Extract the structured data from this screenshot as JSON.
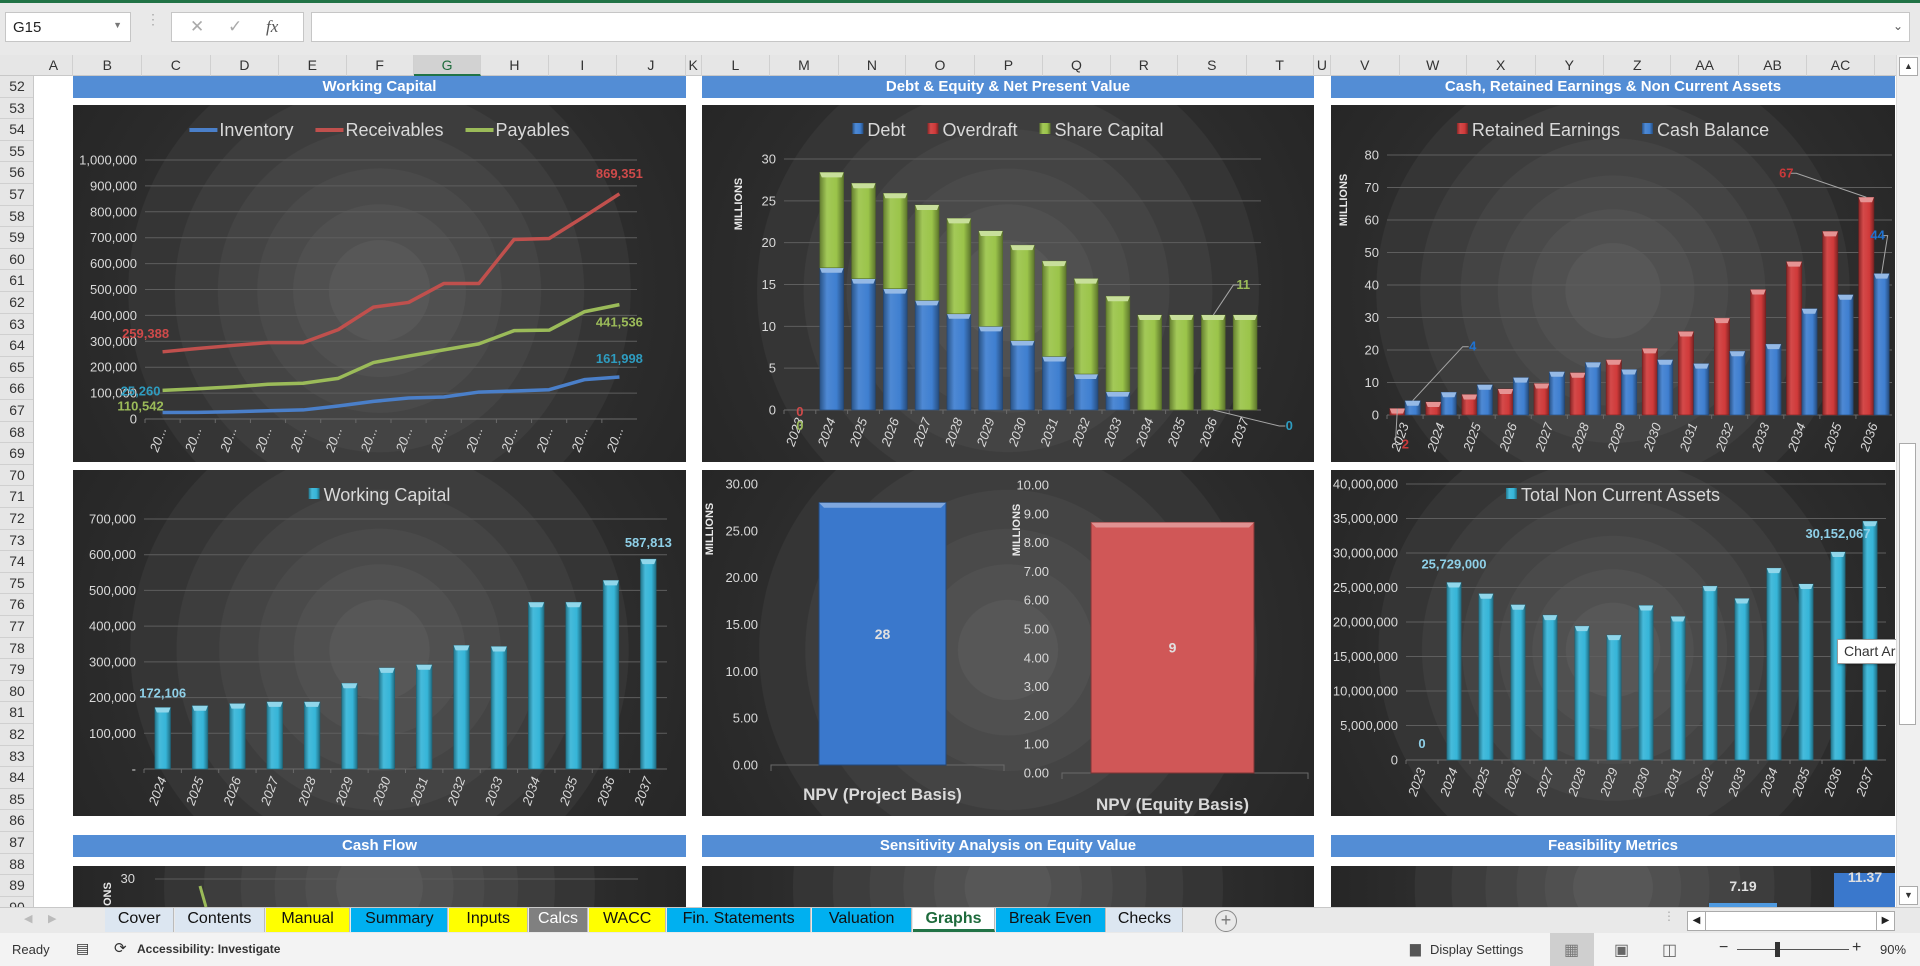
{
  "formula_bar": {
    "name_box": "G15",
    "cancel_icon": "✕",
    "enter_icon": "✓",
    "fx_label": "fx",
    "formula": ""
  },
  "columns": [
    "A",
    "B",
    "C",
    "D",
    "E",
    "F",
    "G",
    "H",
    "I",
    "J",
    "K",
    "L",
    "M",
    "N",
    "O",
    "P",
    "Q",
    "R",
    "S",
    "T",
    "U",
    "V",
    "W",
    "X",
    "Y",
    "Z",
    "AA",
    "AB",
    "AC"
  ],
  "selected_column": "G",
  "rows": [
    52,
    53,
    54,
    55,
    56,
    57,
    58,
    59,
    60,
    61,
    62,
    63,
    64,
    65,
    66,
    67,
    68,
    69,
    70,
    71,
    72,
    73,
    74,
    75,
    76,
    77,
    78,
    79,
    80,
    81,
    82,
    83,
    84,
    85,
    86,
    87,
    88,
    89,
    90
  ],
  "sections": {
    "working_capital": "Working Capital",
    "debt_equity": "Debt & Equity & Net Present Value",
    "cash_re": "Cash, Retained Earnings & Non Current Assets",
    "cash_flow": "Cash Flow",
    "sensitivity": "Sensitivity Analysis on Equity Value",
    "feasibility": "Feasibility Metrics"
  },
  "chart_data": [
    {
      "id": "wc_lines",
      "type": "line",
      "x_tick_labels": [
        "20...",
        "20...",
        "20...",
        "20...",
        "20...",
        "20...",
        "20...",
        "20...",
        "20...",
        "20...",
        "20...",
        "20...",
        "20...",
        "20..."
      ],
      "ylim": [
        0,
        1000000
      ],
      "y_tick_labels": [
        "0",
        "100,000",
        "200,000",
        "300,000",
        "400,000",
        "500,000",
        "600,000",
        "700,000",
        "800,000",
        "900,000",
        "1,000,000"
      ],
      "grid": true,
      "legend": "top",
      "series": [
        {
          "name": "Inventory",
          "color": "#4a7fc9",
          "values": [
            25260,
            25500,
            28000,
            32000,
            35000,
            50000,
            68000,
            81000,
            85000,
            104000,
            108000,
            113000,
            152000,
            161998
          ]
        },
        {
          "name": "Receivables",
          "color": "#c0504d",
          "values": [
            259388,
            272000,
            284000,
            295000,
            295000,
            345000,
            432000,
            450000,
            523000,
            523000,
            693000,
            697000,
            782000,
            869351
          ]
        },
        {
          "name": "Payables",
          "color": "#9bbb59",
          "values": [
            110542,
            117000,
            124000,
            134000,
            138000,
            157000,
            218000,
            243000,
            267000,
            290000,
            341000,
            343000,
            414000,
            441536
          ]
        }
      ],
      "data_labels": [
        {
          "series": 1,
          "index": 0,
          "text": "259,388",
          "color": "#d04a4a"
        },
        {
          "series": 1,
          "index": 13,
          "text": "869,351",
          "color": "#d04a4a"
        },
        {
          "series": 2,
          "index": 13,
          "text": "441,536",
          "color": "#9bbb59"
        },
        {
          "series": 0,
          "index": 13,
          "text": "161,998",
          "color": "#2e9cc0"
        },
        {
          "series": 0,
          "index": 0,
          "text": "25,260",
          "color": "#2e9cc0"
        },
        {
          "series": 2,
          "index": 0,
          "text": "110,542",
          "color": "#9bbb59"
        }
      ]
    },
    {
      "id": "debt_equity",
      "type": "bar",
      "stacked": true,
      "x_tick_labels": [
        "2023",
        "2024",
        "2025",
        "2026",
        "2027",
        "2028",
        "2029",
        "2030",
        "2031",
        "2032",
        "2033",
        "2034",
        "2035",
        "2036",
        "2037"
      ],
      "ylim": [
        0,
        30
      ],
      "y_tick_labels": [
        "0",
        "5",
        "10",
        "15",
        "20",
        "25",
        "30"
      ],
      "ylabel": "MILLIONS",
      "grid": true,
      "legend": "top",
      "series": [
        {
          "name": "Debt",
          "color": "#3f7fd0",
          "values": [
            0,
            17.0,
            15.7,
            14.5,
            13.1,
            11.5,
            10.0,
            8.3,
            6.4,
            4.3,
            2.2,
            0,
            0,
            0,
            0
          ]
        },
        {
          "name": "Overdraft",
          "color": "#d03a3a",
          "values": [
            0,
            0,
            0,
            0,
            0,
            0,
            0,
            0,
            0,
            0,
            0,
            0,
            0,
            0,
            0
          ]
        },
        {
          "name": "Share Capital",
          "color": "#9bc44a",
          "values": [
            0,
            11.4,
            11.4,
            11.4,
            11.4,
            11.4,
            11.4,
            11.4,
            11.4,
            11.4,
            11.4,
            11.35,
            11.35,
            11.35,
            11.35
          ]
        }
      ],
      "data_labels": [
        {
          "series": 1,
          "index": 0,
          "text": "0",
          "color": "#d04a4a"
        },
        {
          "series": 2,
          "index": 0,
          "text": "0",
          "color": "#9bbb59"
        },
        {
          "series": 2,
          "index": 13,
          "text": "11",
          "color": "#9bbb59"
        },
        {
          "series": 0,
          "index": 13,
          "text": "0",
          "color": "#2e9cc0"
        }
      ]
    },
    {
      "id": "cash_re",
      "type": "bar",
      "stacked": false,
      "x_tick_labels": [
        "2023",
        "2024",
        "2025",
        "2026",
        "2027",
        "2028",
        "2029",
        "2030",
        "2031",
        "2032",
        "2033",
        "2034",
        "2035",
        "2036"
      ],
      "ylim": [
        0,
        80
      ],
      "y_tick_labels": [
        "0",
        "10",
        "20",
        "30",
        "40",
        "50",
        "60",
        "70",
        "80"
      ],
      "ylabel": "MILLIONS",
      "grid": true,
      "legend": "top",
      "series": [
        {
          "name": "Retained Earnings",
          "color": "#d03a3a",
          "values": [
            2,
            4,
            6.3,
            8,
            9.7,
            13,
            17,
            20.5,
            25.7,
            29.8,
            38.6,
            47.2,
            56.5,
            67
          ]
        },
        {
          "name": "Cash Balance",
          "color": "#3f7fd0",
          "values": [
            4.4,
            7,
            9.3,
            11.5,
            13.3,
            16.2,
            14,
            17,
            15.8,
            19.6,
            21.8,
            32.7,
            37,
            43.5
          ]
        }
      ],
      "data_labels": [
        {
          "series": 0,
          "index": 0,
          "text": "2",
          "color": "#c9393a"
        },
        {
          "series": 1,
          "index": 0,
          "text": "4",
          "color": "#1f72d0"
        },
        {
          "series": 0,
          "index": 13,
          "text": "67",
          "color": "#c9393a"
        },
        {
          "series": 1,
          "index": 13,
          "text": "44",
          "color": "#1f72d0"
        }
      ]
    },
    {
      "id": "wc_bars",
      "type": "bar",
      "stacked": false,
      "x_tick_labels": [
        "2024",
        "2025",
        "2026",
        "2027",
        "2028",
        "2029",
        "2030",
        "2031",
        "2032",
        "2033",
        "2034",
        "2035",
        "2036",
        "2037"
      ],
      "ylim": [
        0,
        700000
      ],
      "y_tick_labels": [
        "-",
        "100,000",
        "200,000",
        "300,000",
        "400,000",
        "500,000",
        "600,000",
        "700,000"
      ],
      "grid": true,
      "legend": "top",
      "series": [
        {
          "name": "Working Capital",
          "color": "#36b5d8",
          "values": [
            172106,
            177000,
            183000,
            188000,
            188000,
            240000,
            283000,
            292000,
            346000,
            343000,
            467000,
            467000,
            528000,
            587813
          ]
        }
      ],
      "data_labels": [
        {
          "series": 0,
          "index": 0,
          "text": "172,106",
          "color": "#8fd0e8"
        },
        {
          "series": 0,
          "index": 13,
          "text": "587,813",
          "color": "#8fd0e8"
        }
      ]
    },
    {
      "id": "npv_project",
      "type": "bar",
      "categories": [
        "NPV (Project Basis)"
      ],
      "values": [
        28.0
      ],
      "color": "#3a78cc",
      "ylim": [
        0,
        30
      ],
      "y_tick_labels": [
        "0.00",
        "5.00",
        "10.00",
        "15.00",
        "20.00",
        "25.00",
        "30.00"
      ],
      "ylabel": "MILLIONS",
      "data_label": "28"
    },
    {
      "id": "npv_equity",
      "type": "bar",
      "categories": [
        "NPV (Equity Basis)"
      ],
      "values": [
        8.7
      ],
      "color": "#d05757",
      "ylim": [
        0,
        10
      ],
      "y_tick_labels": [
        "0.00",
        "1.00",
        "2.00",
        "3.00",
        "4.00",
        "5.00",
        "6.00",
        "7.00",
        "8.00",
        "9.00",
        "10.00"
      ],
      "ylabel": "MILLIONS",
      "data_label": "9"
    },
    {
      "id": "tnca",
      "type": "bar",
      "stacked": false,
      "x_tick_labels": [
        "2023",
        "2024",
        "2025",
        "2026",
        "2027",
        "2028",
        "2029",
        "2030",
        "2031",
        "2032",
        "2033",
        "2034",
        "2035",
        "2036",
        "2037"
      ],
      "ylim": [
        0,
        40000000
      ],
      "y_tick_labels": [
        "0",
        "5,000,000",
        "10,000,000",
        "15,000,000",
        "20,000,000",
        "25,000,000",
        "30,000,000",
        "35,000,000",
        "40,000,000"
      ],
      "grid": true,
      "legend": "top",
      "series": [
        {
          "name": "Total Non Current Assets",
          "color": "#36b5d8",
          "values": [
            0,
            25729000,
            24100000,
            22500000,
            21000000,
            19400000,
            18100000,
            22400000,
            20800000,
            25200000,
            23400000,
            27800000,
            25500000,
            30152067,
            34600000
          ]
        }
      ],
      "data_labels": [
        {
          "series": 0,
          "index": 0,
          "text": "0",
          "color": "#8fd0e8"
        },
        {
          "series": 0,
          "index": 1,
          "text": "25,729,000",
          "color": "#8fd0e8"
        },
        {
          "series": 0,
          "index": 13,
          "text": "30,152,067",
          "color": "#8fd0e8"
        }
      ]
    }
  ],
  "partial_charts": {
    "cash_flow": {
      "y_tick_top": "30",
      "ylabel_fragment": "ONS"
    },
    "feasibility": {
      "labels": [
        "7.19",
        "11.37"
      ]
    }
  },
  "tooltip": "Chart Area",
  "sheet_tabs": [
    {
      "label": "Cover",
      "color": "#dce6f1"
    },
    {
      "label": "Contents",
      "color": "#dce6f1"
    },
    {
      "label": "Manual",
      "color": "#ffff00"
    },
    {
      "label": "Summary",
      "color": "#00b0f0"
    },
    {
      "label": "Inputs",
      "color": "#ffff00"
    },
    {
      "label": "Calcs",
      "color": "#808080"
    },
    {
      "label": "WACC",
      "color": "#ffff00"
    },
    {
      "label": "Fin. Statements",
      "color": "#00b0f0"
    },
    {
      "label": "Valuation",
      "color": "#00b0f0"
    },
    {
      "label": "Graphs",
      "color": "#ffffff",
      "active": true
    },
    {
      "label": "Break Even",
      "color": "#00b0f0"
    },
    {
      "label": "Checks",
      "color": "#dce6f1"
    }
  ],
  "status_bar": {
    "ready": "Ready",
    "accessibility": "Accessibility: Investigate",
    "display_settings": "Display Settings",
    "zoom_minus": "−",
    "zoom_plus": "+",
    "zoom": "90%",
    "zoom_level_percent": 90
  }
}
